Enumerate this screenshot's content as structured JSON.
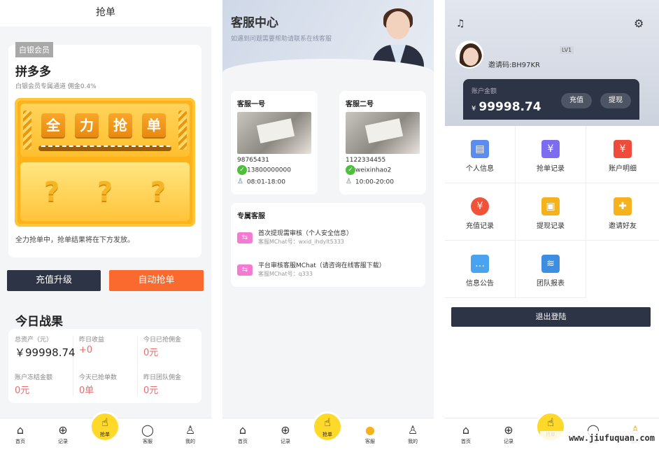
{
  "panel1": {
    "title": "抢单",
    "badge": "白银会员",
    "card_title": "拼多多",
    "card_sub": "白银会员专属通道 佣金0.4%",
    "slot_chars": [
      "全",
      "力",
      "抢",
      "单"
    ],
    "qmarks": [
      "?",
      "?",
      "?"
    ],
    "note": "全力抢单中，抢单结果将在下方发放。",
    "btn_recharge": "充值升级",
    "btn_auto": "自动抢单",
    "today_title": "今日战果",
    "stats": [
      {
        "label": "总资产（元）",
        "value": "￥99998.74"
      },
      {
        "label": "昨日收益",
        "value": "+0"
      },
      {
        "label": "今日已抢佣金",
        "value": "0元"
      },
      {
        "label": "账户冻结金额",
        "value": "0元"
      },
      {
        "label": "今天已抢单数",
        "value": "0单"
      },
      {
        "label": "昨日团队佣金",
        "value": "0元"
      }
    ]
  },
  "tabs": {
    "home": "首页",
    "records": "记录",
    "grab": "抢单",
    "service": "客服",
    "mine": "我的"
  },
  "panel2": {
    "title": "客服中心",
    "subtitle": "如遇到问题需要帮助请联系在线客服",
    "agents": [
      {
        "name": "客服一号",
        "id": "98765431",
        "wechat": "13800000000",
        "hours": "08:01-18:00"
      },
      {
        "name": "客服二号",
        "id": "1122334455",
        "wechat": "weixinhao2",
        "hours": "10:00-20:00"
      }
    ],
    "exclusive_title": "专属客服",
    "exclusive": [
      {
        "title": "首次提现需审核（个人安全信息）",
        "sub": "客服MChat号：wxid_ihdylt5333"
      },
      {
        "title": "平台审核客服MChat（请咨询在线客服下载）",
        "sub": "客服MChat号：q333"
      }
    ]
  },
  "panel3": {
    "level": "LV1",
    "invite": "邀请码:BH97KR",
    "balance_label": "账户金额",
    "currency": "¥",
    "balance": "99998.74",
    "btn_recharge": "充值",
    "btn_withdraw": "提现",
    "menu": [
      {
        "label": "个人信息",
        "icon": "id-card-icon",
        "color": "#5b8def"
      },
      {
        "label": "抢单记录",
        "icon": "receipt-icon",
        "color": "#7b6cf0"
      },
      {
        "label": "账户明细",
        "icon": "bill-icon",
        "color": "#f04a3a"
      },
      {
        "label": "充值记录",
        "icon": "money-bag-icon",
        "color": "#f0533a"
      },
      {
        "label": "提现记录",
        "icon": "wallet-icon",
        "color": "#f5b21c"
      },
      {
        "label": "邀请好友",
        "icon": "gift-icon",
        "color": "#f5b21c"
      },
      {
        "label": "信息公告",
        "icon": "chat-icon",
        "color": "#4aa3ef"
      },
      {
        "label": "团队报表",
        "icon": "layers-icon",
        "color": "#3d8de0"
      }
    ],
    "logout": "退出登陆"
  },
  "watermark": "www.jiufuquan.com"
}
